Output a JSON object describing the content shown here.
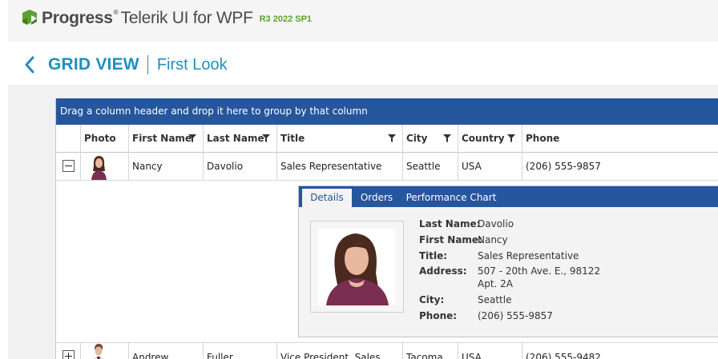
{
  "header": {
    "brand": "Progress",
    "brand_mark": "®",
    "product": "Telerik UI for WPF",
    "version": "R3 2022 SP1"
  },
  "page": {
    "title": "GRID VIEW",
    "subtitle": "First Look"
  },
  "grid": {
    "group_panel_text": "Drag a column header and drop it here to group by that column",
    "columns": [
      "Photo",
      "First Name",
      "Last Name",
      "Title",
      "City",
      "Country",
      "Phone"
    ],
    "rows": [
      {
        "first_name": "Nancy",
        "last_name": "Davolio",
        "title": "Sales Representative",
        "city": "Seattle",
        "country": "USA",
        "phone": "(206) 555-9857",
        "expanded": true
      },
      {
        "first_name": "Andrew",
        "last_name": "Fuller",
        "title": "Vice President, Sales",
        "city": "Tacoma",
        "country": "USA",
        "phone": "(206) 555-9482",
        "expanded": false
      }
    ]
  },
  "details": {
    "tabs": [
      "Details",
      "Orders",
      "Performance Chart"
    ],
    "selected_tab": "Details",
    "labels": {
      "last_name": "Last Name:",
      "first_name": "First Name:",
      "title": "Title:",
      "address": "Address:",
      "city": "City:",
      "phone": "Phone:"
    },
    "values": {
      "last_name": "Davolio",
      "first_name": "Nancy",
      "title": "Sales Representative",
      "address_line1": "507 - 20th Ave. E., 98122",
      "address_line2": "Apt. 2A",
      "city": "Seattle",
      "phone": "(206) 555-9857"
    }
  },
  "colors": {
    "accent": "#1f8fc1",
    "grid_blue": "#25569e",
    "brand_green": "#5ca22e"
  }
}
